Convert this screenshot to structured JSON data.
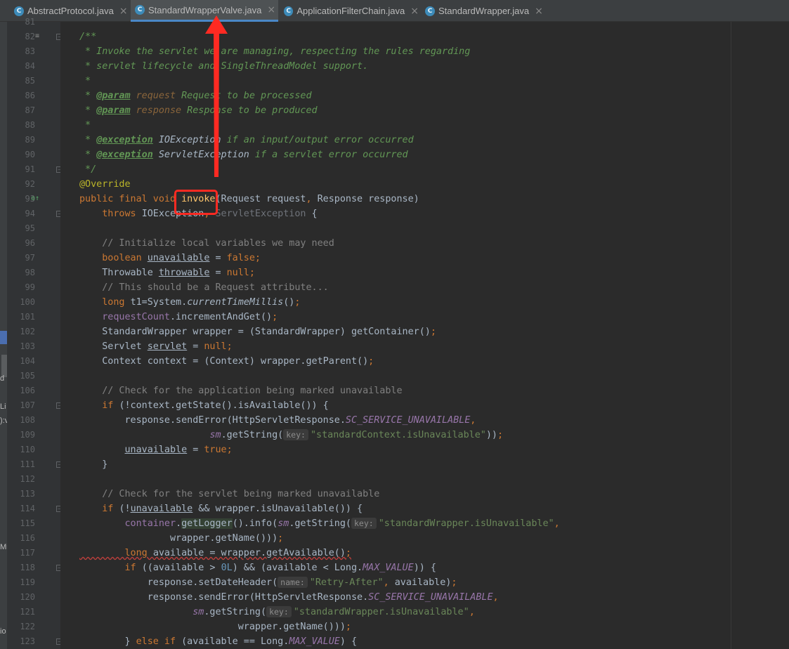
{
  "tabs": [
    {
      "label": "AbstractProtocol.java",
      "icon": "C",
      "active": false
    },
    {
      "label": "StandardWrapperValve.java",
      "icon": "C",
      "active": true
    },
    {
      "label": "ApplicationFilterChain.java",
      "icon": "C",
      "active": false
    },
    {
      "label": "StandardWrapper.java",
      "icon": "C",
      "active": false
    }
  ],
  "close_glyph": "×",
  "left_strip": {
    "markers": [
      "d",
      "Li",
      "):v",
      "Mi",
      "io"
    ]
  },
  "line_numbers": [
    "81",
    "82",
    "83",
    "84",
    "85",
    "86",
    "87",
    "88",
    "89",
    "90",
    "91",
    "92",
    "93",
    "94",
    "95",
    "96",
    "97",
    "98",
    "99",
    "100",
    "101",
    "102",
    "103",
    "104",
    "105",
    "106",
    "107",
    "108",
    "109",
    "110",
    "111",
    "112",
    "113",
    "114",
    "115",
    "116",
    "117",
    "118",
    "119",
    "120",
    "121",
    "122",
    "123"
  ],
  "code_lines": [
    [],
    [
      {
        "t": "/**",
        "c": "doc"
      }
    ],
    [
      {
        "t": " * Invoke the servlet we are managing, respecting the rules regarding",
        "c": "doc"
      }
    ],
    [
      {
        "t": " * servlet lifecycle and SingleThreadModel support.",
        "c": "doc"
      }
    ],
    [
      {
        "t": " *",
        "c": "doc"
      }
    ],
    [
      {
        "t": " * ",
        "c": "doc"
      },
      {
        "t": "@param",
        "c": "tag"
      },
      {
        "t": " request",
        "c": "docparam"
      },
      {
        "t": " Request to be processed",
        "c": "doc"
      }
    ],
    [
      {
        "t": " * ",
        "c": "doc"
      },
      {
        "t": "@param",
        "c": "tag"
      },
      {
        "t": " response",
        "c": "docparam"
      },
      {
        "t": " Response to be produced",
        "c": "doc"
      }
    ],
    [
      {
        "t": " *",
        "c": "doc"
      }
    ],
    [
      {
        "t": " * ",
        "c": "doc"
      },
      {
        "t": "@exception",
        "c": "tag"
      },
      {
        "t": " IOException",
        "c": "docref"
      },
      {
        "t": " if an input/output error occurred",
        "c": "doc"
      }
    ],
    [
      {
        "t": " * ",
        "c": "doc"
      },
      {
        "t": "@exception",
        "c": "tag"
      },
      {
        "t": " ServletException",
        "c": "docref"
      },
      {
        "t": " if a servlet error occurred",
        "c": "doc"
      }
    ],
    [
      {
        "t": " */",
        "c": "doc"
      }
    ],
    [
      {
        "t": "@Override",
        "c": "ann"
      }
    ],
    [
      {
        "t": "public final void ",
        "c": "kw"
      },
      {
        "t": "invoke",
        "c": "fn"
      },
      {
        "t": "(Request request",
        "c": "plain"
      },
      {
        "t": ", ",
        "c": "kw"
      },
      {
        "t": "Response response)",
        "c": "plain"
      }
    ],
    [
      {
        "t": "    throws ",
        "c": "kw"
      },
      {
        "t": "IOException",
        "c": "plain"
      },
      {
        "t": ", ",
        "c": "kw"
      },
      {
        "t": "ServletException",
        "c": "dim"
      },
      {
        "t": " {",
        "c": "plain"
      }
    ],
    [],
    [
      {
        "t": "    // Initialize local variables we may need",
        "c": "cmt"
      }
    ],
    [
      {
        "t": "    boolean ",
        "c": "kw"
      },
      {
        "t": "unavailable",
        "c": "plain ul"
      },
      {
        "t": " = ",
        "c": "plain"
      },
      {
        "t": "false;",
        "c": "kw"
      }
    ],
    [
      {
        "t": "    Throwable ",
        "c": "plain"
      },
      {
        "t": "throwable",
        "c": "plain ul"
      },
      {
        "t": " = ",
        "c": "plain"
      },
      {
        "t": "null;",
        "c": "kw"
      }
    ],
    [
      {
        "t": "    // This should be a Request attribute...",
        "c": "cmt"
      }
    ],
    [
      {
        "t": "    long ",
        "c": "kw"
      },
      {
        "t": "t1=System.",
        "c": "plain"
      },
      {
        "t": "currentTimeMillis",
        "c": "sm"
      },
      {
        "t": "()",
        "c": "plain"
      },
      {
        "t": ";",
        "c": "kw"
      }
    ],
    [
      {
        "t": "    ",
        "c": "plain"
      },
      {
        "t": "requestCount",
        "c": "field"
      },
      {
        "t": ".incrementAndGet()",
        "c": "plain"
      },
      {
        "t": ";",
        "c": "kw"
      }
    ],
    [
      {
        "t": "    StandardWrapper wrapper = (StandardWrapper) getContainer()",
        "c": "plain"
      },
      {
        "t": ";",
        "c": "kw"
      }
    ],
    [
      {
        "t": "    Servlet ",
        "c": "plain"
      },
      {
        "t": "servlet",
        "c": "plain ul"
      },
      {
        "t": " = ",
        "c": "plain"
      },
      {
        "t": "null;",
        "c": "kw"
      }
    ],
    [
      {
        "t": "    Context context = (Context) wrapper.getParent()",
        "c": "plain"
      },
      {
        "t": ";",
        "c": "kw"
      }
    ],
    [],
    [
      {
        "t": "    // Check for the application being marked unavailable",
        "c": "cmt"
      }
    ],
    [
      {
        "t": "    if ",
        "c": "kw"
      },
      {
        "t": "(!context.getState().isAvailable()) {",
        "c": "plain"
      }
    ],
    [
      {
        "t": "        response.sendError(HttpServletResponse.",
        "c": "plain"
      },
      {
        "t": "SC_SERVICE_UNAVAILABLE",
        "c": "static"
      },
      {
        "t": ",",
        "c": "kw"
      }
    ],
    [
      {
        "t": "                       ",
        "c": "plain"
      },
      {
        "t": "sm",
        "c": "static"
      },
      {
        "t": ".getString(",
        "c": "plain"
      },
      {
        "t": "key:",
        "c": "hint"
      },
      {
        "t": "\"standardContext.isUnavailable\"",
        "c": "str"
      },
      {
        "t": "))",
        "c": "plain"
      },
      {
        "t": ";",
        "c": "kw"
      }
    ],
    [
      {
        "t": "        ",
        "c": "plain"
      },
      {
        "t": "unavailable",
        "c": "plain ul"
      },
      {
        "t": " = ",
        "c": "plain"
      },
      {
        "t": "true;",
        "c": "kw"
      }
    ],
    [
      {
        "t": "    }",
        "c": "plain"
      }
    ],
    [],
    [
      {
        "t": "    // Check for the servlet being marked unavailable",
        "c": "cmt"
      }
    ],
    [
      {
        "t": "    if ",
        "c": "kw"
      },
      {
        "t": "(!",
        "c": "plain"
      },
      {
        "t": "unavailable",
        "c": "plain ul"
      },
      {
        "t": " && wrapper.isUnavailable()) {",
        "c": "plain"
      }
    ],
    [
      {
        "t": "        ",
        "c": "plain"
      },
      {
        "t": "container",
        "c": "field"
      },
      {
        "t": ".",
        "c": "plain"
      },
      {
        "t": "getLogger",
        "c": "plain hl"
      },
      {
        "t": "().info(",
        "c": "plain"
      },
      {
        "t": "sm",
        "c": "static"
      },
      {
        "t": ".getString(",
        "c": "plain"
      },
      {
        "t": "key:",
        "c": "hint"
      },
      {
        "t": "\"standardWrapper.isUnavailable\"",
        "c": "str"
      },
      {
        "t": ",",
        "c": "kw"
      }
    ],
    [
      {
        "t": "                wrapper.getName()))",
        "c": "plain"
      },
      {
        "t": ";",
        "c": "kw"
      }
    ],
    [
      {
        "t": "        long ",
        "c": "kw squig"
      },
      {
        "t": "available = wrapper.getAvailable()",
        "c": "plain squig"
      },
      {
        "t": ";",
        "c": "kw squig"
      }
    ],
    [
      {
        "t": "        if ",
        "c": "kw"
      },
      {
        "t": "((available > ",
        "c": "plain"
      },
      {
        "t": "0L",
        "c": "num"
      },
      {
        "t": ") && (available < Long.",
        "c": "plain"
      },
      {
        "t": "MAX_VALUE",
        "c": "static"
      },
      {
        "t": ")) {",
        "c": "plain"
      }
    ],
    [
      {
        "t": "            response.setDateHeader(",
        "c": "plain"
      },
      {
        "t": "name:",
        "c": "hint"
      },
      {
        "t": "\"Retry-After\"",
        "c": "str"
      },
      {
        "t": ", ",
        "c": "kw"
      },
      {
        "t": "available)",
        "c": "plain"
      },
      {
        "t": ";",
        "c": "kw"
      }
    ],
    [
      {
        "t": "            response.sendError(HttpServletResponse.",
        "c": "plain"
      },
      {
        "t": "SC_SERVICE_UNAVAILABLE",
        "c": "static"
      },
      {
        "t": ",",
        "c": "kw"
      }
    ],
    [
      {
        "t": "                    ",
        "c": "plain"
      },
      {
        "t": "sm",
        "c": "static"
      },
      {
        "t": ".getString(",
        "c": "plain"
      },
      {
        "t": "key:",
        "c": "hint"
      },
      {
        "t": "\"standardWrapper.isUnavailable\"",
        "c": "str"
      },
      {
        "t": ",",
        "c": "kw"
      }
    ],
    [
      {
        "t": "                            wrapper.getName()))",
        "c": "plain"
      },
      {
        "t": ";",
        "c": "kw"
      }
    ],
    [
      {
        "t": "        } ",
        "c": "plain"
      },
      {
        "t": "else if ",
        "c": "kw"
      },
      {
        "t": "(available == Long.",
        "c": "plain"
      },
      {
        "t": "MAX_VALUE",
        "c": "static"
      },
      {
        "t": ") {",
        "c": "plain"
      }
    ]
  ],
  "gutter_marks": {
    "82": "≡",
    "93": "o↑"
  },
  "fold_lines": [
    "82",
    "91",
    "94",
    "107",
    "111",
    "114",
    "118",
    "123"
  ],
  "colors": {
    "annotation_red": "#ff2a22",
    "tab_accent": "#4a88c7",
    "background": "#2b2b2b"
  }
}
